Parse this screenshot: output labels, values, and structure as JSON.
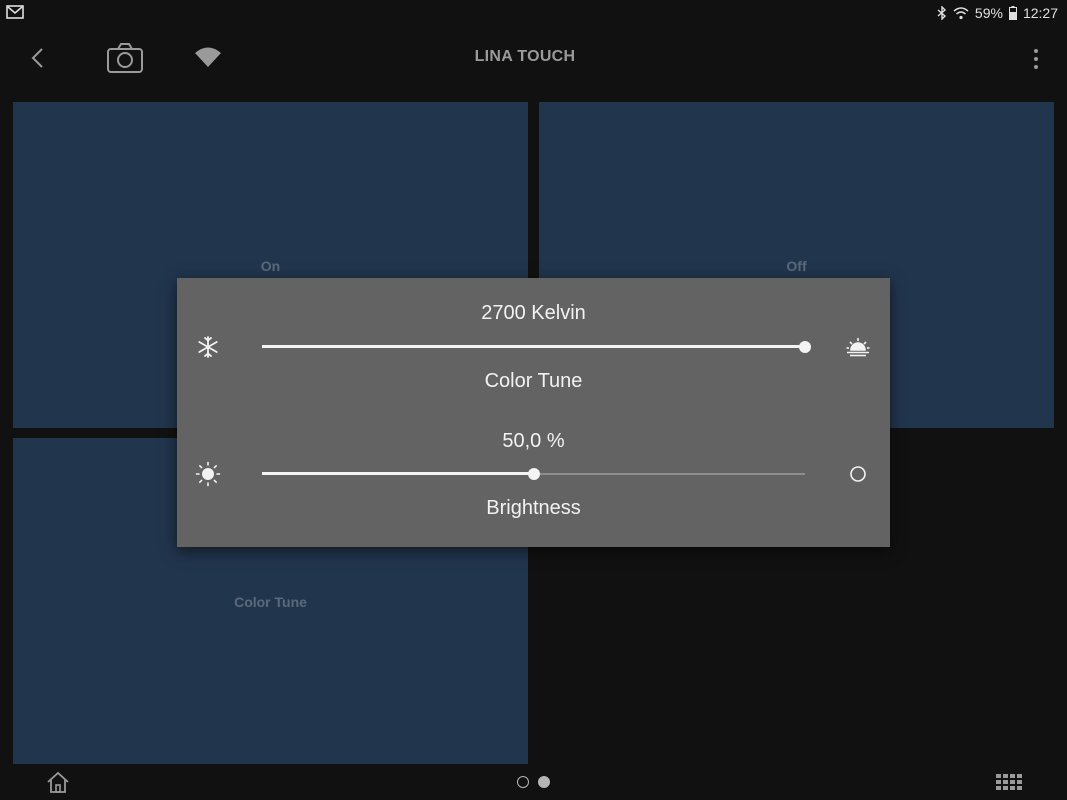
{
  "status_bar": {
    "battery_percent": "59%",
    "time": "12:27",
    "icons": [
      "gmail-icon",
      "bluetooth-icon",
      "wifi-icon",
      "battery-icon"
    ]
  },
  "app_bar": {
    "title": "LINA TOUCH",
    "icons": [
      "back-arrow-icon",
      "camera-icon",
      "wifi-icon",
      "overflow-menu-icon"
    ]
  },
  "tiles": {
    "on_label": "On",
    "off_label": "Off",
    "color_tune_label": "Color Tune"
  },
  "dialog": {
    "color_tune": {
      "value_text": "2700 Kelvin",
      "caption": "Color Tune",
      "level": 1.0,
      "left_icon": "snowflake-icon",
      "right_icon": "sunset-icon"
    },
    "brightness": {
      "value_text": "50,0 %",
      "caption": "Brightness",
      "level": 0.5,
      "left_icon": "sun-bright-icon",
      "right_icon": "circle-dim-icon"
    }
  },
  "bottom_bar": {
    "page_count": 2,
    "active_page": 2,
    "icons": [
      "home-icon",
      "grid-icon"
    ]
  },
  "colors": {
    "background": "#111111",
    "tile": "#21354d",
    "dialog": "#636363",
    "slider_active": "#f4f4f4",
    "slider_inactive": "#8e8e8e"
  }
}
